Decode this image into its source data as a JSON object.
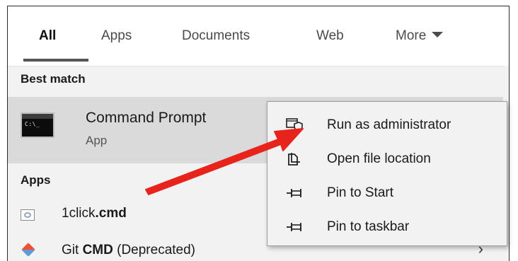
{
  "tabs": [
    {
      "label": "All",
      "active": true
    },
    {
      "label": "Apps",
      "active": false
    },
    {
      "label": "Documents",
      "active": false
    },
    {
      "label": "Web",
      "active": false
    },
    {
      "label": "More",
      "active": false
    }
  ],
  "best_match": {
    "section_label": "Best match",
    "title": "Command Prompt",
    "subtitle": "App",
    "icon": "command-prompt-icon",
    "icon_text": "C:\\_"
  },
  "apps": {
    "section_label": "Apps",
    "items": [
      {
        "name_prefix": "1click",
        "name_bold": ".cmd",
        "name_suffix": "",
        "icon": "cmd-file-icon"
      },
      {
        "name_prefix": "Git ",
        "name_bold": "CMD",
        "name_suffix": " (Deprecated)",
        "icon": "git-icon"
      }
    ]
  },
  "context_menu": {
    "items": [
      {
        "label": "Run as administrator",
        "icon": "shield-icon"
      },
      {
        "label": "Open file location",
        "icon": "folder-icon"
      },
      {
        "label": "Pin to Start",
        "icon": "pin-icon"
      },
      {
        "label": "Pin to taskbar",
        "icon": "pin-icon"
      }
    ]
  },
  "colors": {
    "arrow": "#e8231c",
    "selected_row": "#dadada",
    "panel": "#f2f2f2"
  }
}
